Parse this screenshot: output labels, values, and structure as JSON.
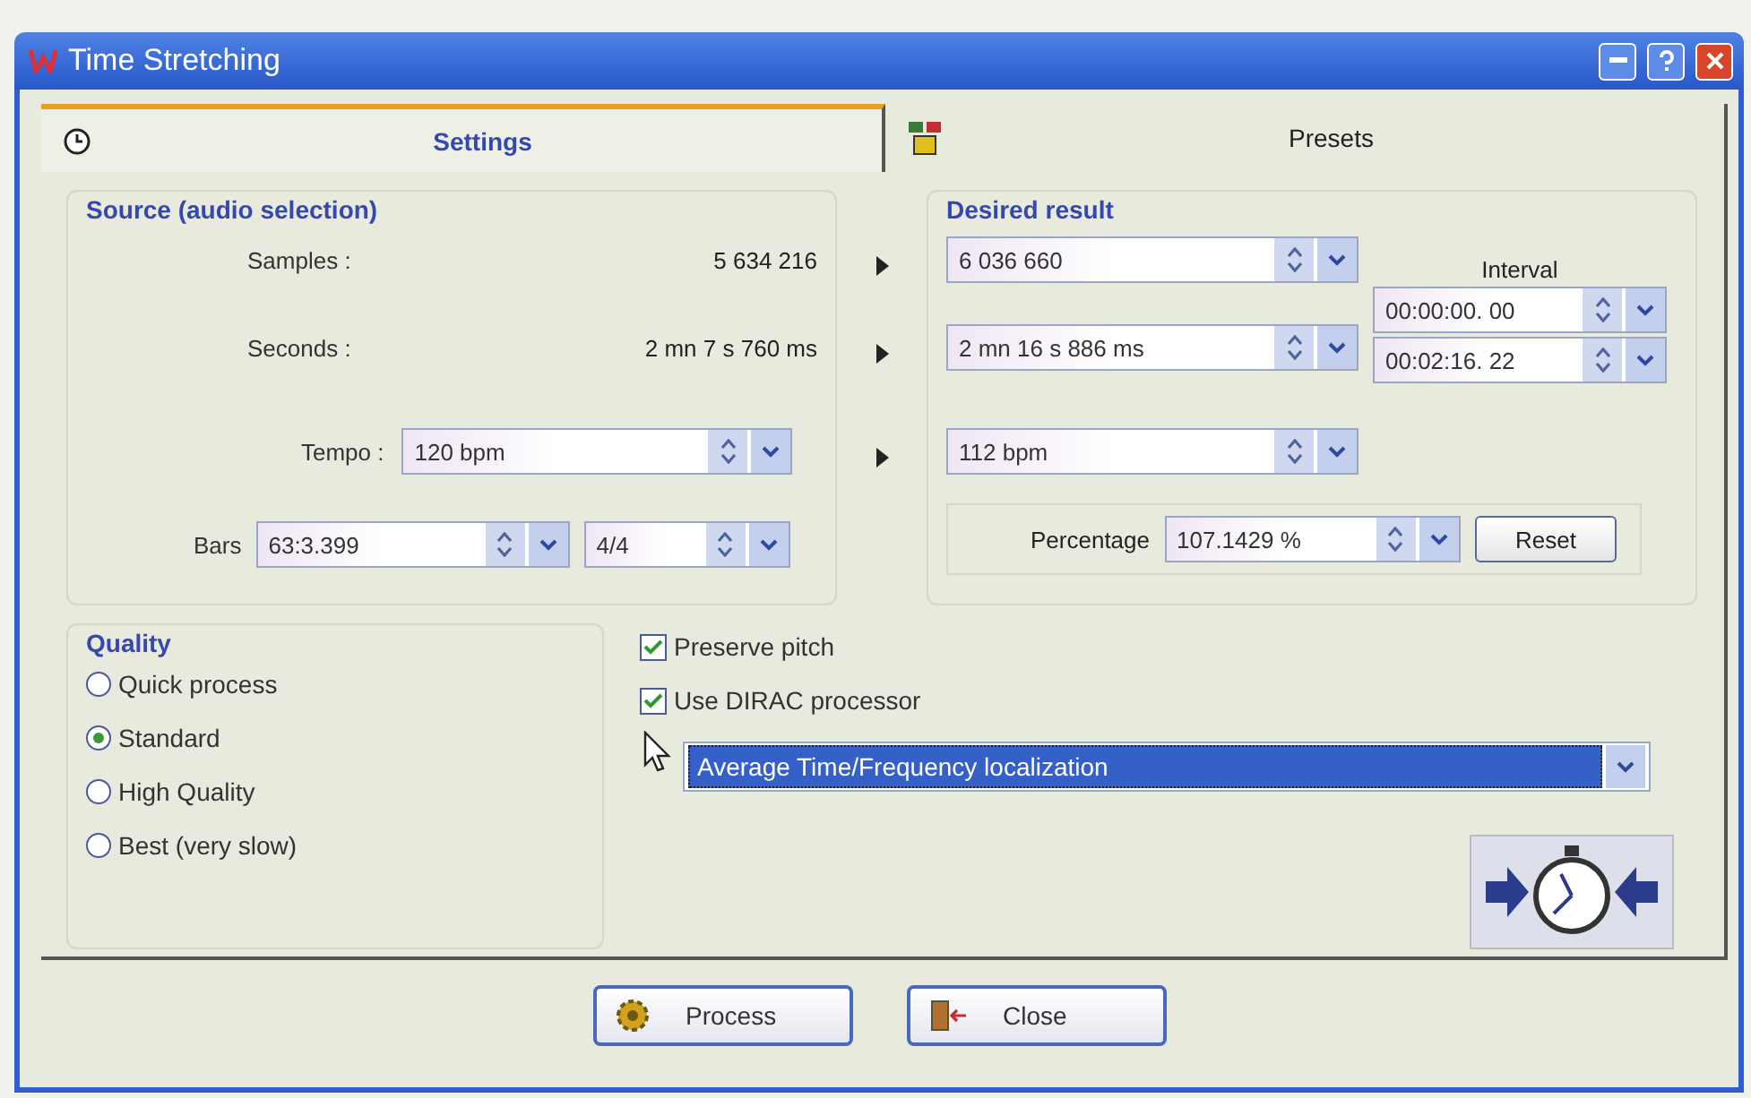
{
  "window": {
    "title": "Time Stretching"
  },
  "tabs": [
    {
      "label": "Settings",
      "selected": true
    },
    {
      "label": "Presets",
      "selected": false
    }
  ],
  "source": {
    "title": "Source (audio selection)",
    "samples": {
      "label": "Samples :",
      "value": "5 634 216"
    },
    "seconds": {
      "label": "Seconds :",
      "value": "2 mn 7 s 760 ms"
    },
    "tempo": {
      "label": "Tempo :",
      "value": "120 bpm"
    },
    "bars": {
      "label": "Bars",
      "value": "63:3.399",
      "signature": "4/4"
    }
  },
  "desired": {
    "title": "Desired result",
    "samples": "6 036 660",
    "seconds": "2 mn 16 s 886 ms",
    "tempo": "112 bpm",
    "interval": {
      "label": "Interval",
      "start": "00:00:00. 00",
      "end": "00:02:16. 22"
    },
    "percentage": {
      "label": "Percentage",
      "value": "107.1429 %"
    },
    "reset": "Reset"
  },
  "quality": {
    "title": "Quality",
    "options": [
      {
        "label": "Quick process",
        "selected": false
      },
      {
        "label": "Standard",
        "selected": true
      },
      {
        "label": "High Quality",
        "selected": false
      },
      {
        "label": "Best (very slow)",
        "selected": false
      }
    ]
  },
  "options": [
    {
      "label": "Preserve pitch",
      "checked": true
    },
    {
      "label": "Use DIRAC processor",
      "checked": true
    }
  ],
  "mode": {
    "value": "Average Time/Frequency localization"
  },
  "buttons": [
    {
      "label": "Process",
      "kind": "process"
    },
    {
      "label": "Close",
      "kind": "close"
    }
  ]
}
